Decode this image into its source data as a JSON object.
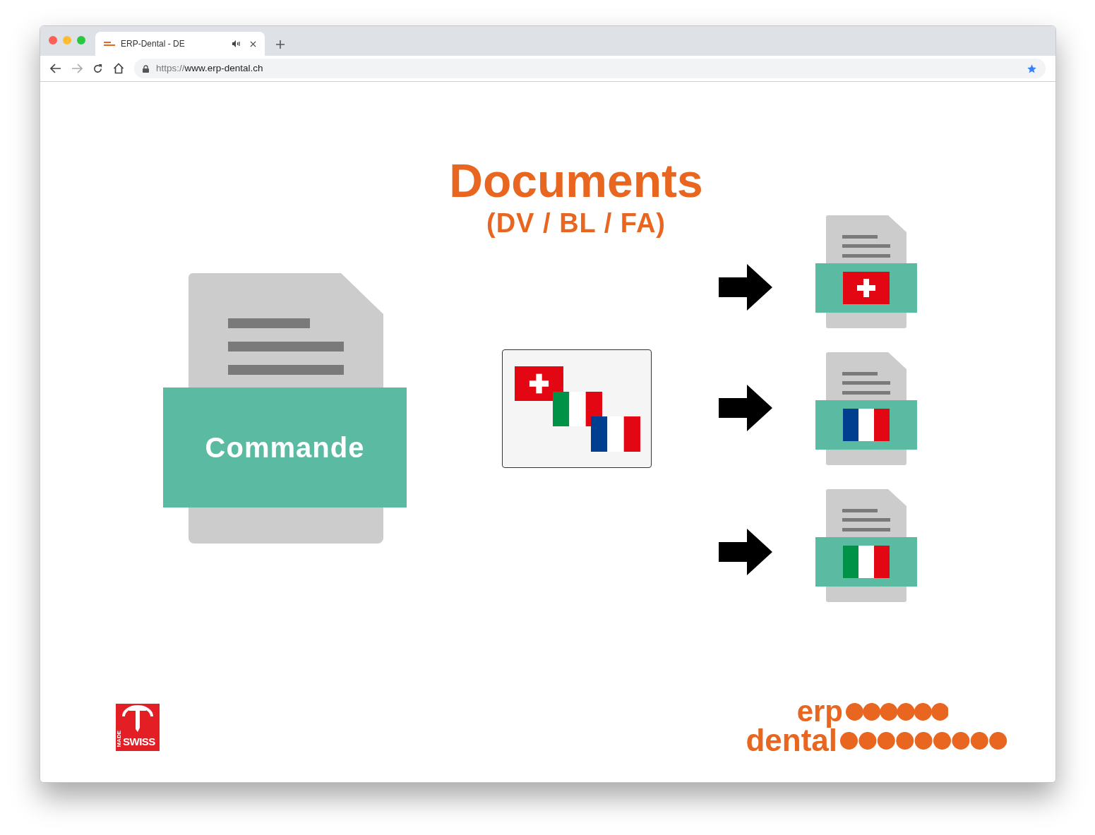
{
  "browser": {
    "tab": {
      "title": "ERP-Dental - DE",
      "audio": true
    },
    "address": {
      "scheme": "https://",
      "host": "www.erp-dental.ch",
      "bookmarked": true
    }
  },
  "slide": {
    "title": "Documents",
    "subtitle": "(DV / BL / FA)",
    "source_document": {
      "label": "Commande"
    },
    "language_flags": [
      {
        "kind": "ch"
      },
      {
        "kind": "it"
      },
      {
        "kind": "fr"
      }
    ],
    "output_documents": [
      {
        "kind": "ch"
      },
      {
        "kind": "fr"
      },
      {
        "kind": "it"
      }
    ]
  },
  "footer": {
    "swiss_logo": {
      "small_text": "MADE",
      "big_text": "SWISS"
    },
    "brand_logo": {
      "line_1": "erp",
      "line_2": "dental"
    }
  }
}
